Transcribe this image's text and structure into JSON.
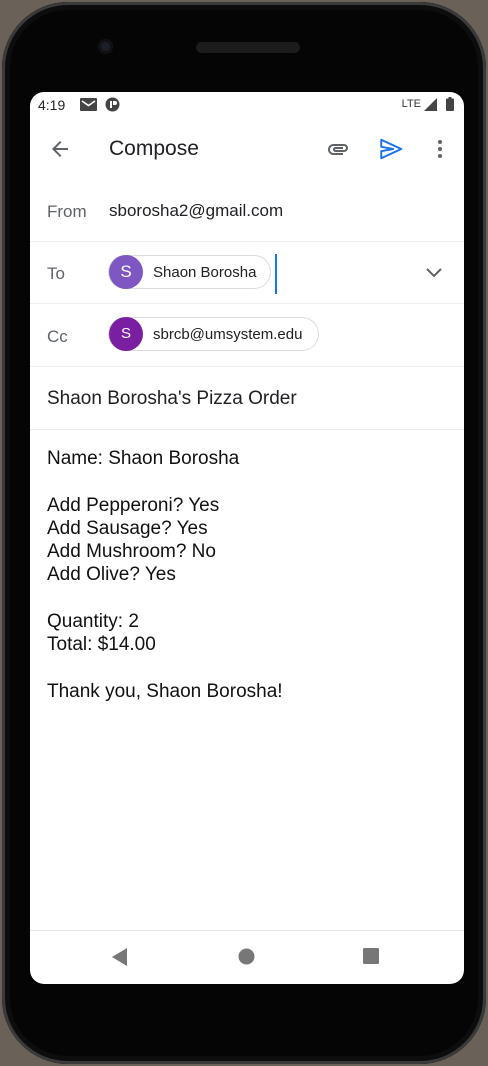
{
  "status_bar": {
    "time": "4:19",
    "network": "LTE",
    "icons": [
      "gmail-icon",
      "app-notification-icon",
      "signal-icon",
      "battery-icon"
    ]
  },
  "app_bar": {
    "title": "Compose",
    "icons": [
      "back-arrow-icon",
      "attach-icon",
      "send-icon",
      "more-vert-icon"
    ],
    "send_color": "#1a73e8"
  },
  "from": {
    "label": "From",
    "value": "sborosha2@gmail.com"
  },
  "to": {
    "label": "To",
    "recipient": {
      "initial": "S",
      "name": "Shaon Borosha",
      "color": "#7e57c2"
    }
  },
  "cc": {
    "label": "Cc",
    "recipient": {
      "initial": "S",
      "name": "sbrcb@umsystem.edu",
      "color": "#7b1fa2"
    }
  },
  "subject": "Shaon Borosha's Pizza Order",
  "body_lines": [
    "Name: Shaon Borosha",
    "",
    "Add Pepperoni? Yes",
    "Add Sausage? Yes",
    "Add Mushroom? No",
    "Add Olive? Yes",
    "",
    "Quantity: 2",
    "Total: $14.00",
    "",
    "Thank you, Shaon Borosha!"
  ],
  "nav_bar": {
    "icons": [
      "nav-back-icon",
      "nav-home-icon",
      "nav-recents-icon"
    ]
  }
}
